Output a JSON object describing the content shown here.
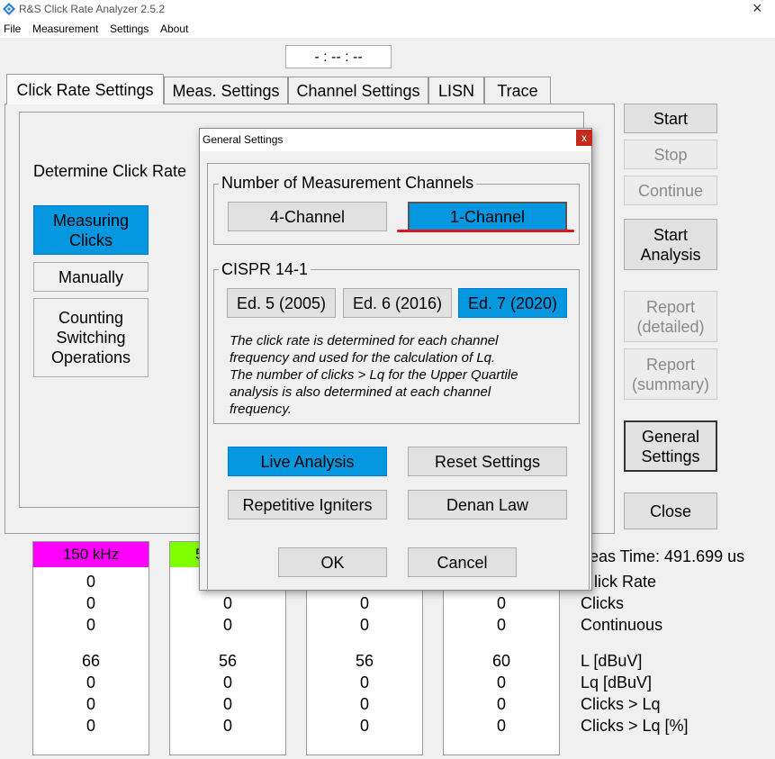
{
  "window": {
    "title": "R&S Click Rate Analyzer 2.5.2",
    "close_glyph": "×"
  },
  "menu": {
    "items": [
      "File",
      "Measurement",
      "Settings",
      "About"
    ]
  },
  "timer": "- :  --  :  --",
  "tabs": [
    "Click Rate Settings",
    "Meas. Settings",
    "Channel Settings",
    "LISN",
    "Trace"
  ],
  "click_rate": {
    "heading": "Determine Click Rate",
    "buttons": [
      "Measuring Clicks",
      "Manually",
      "Counting Switching Operations"
    ]
  },
  "right_buttons": {
    "start": "Start",
    "stop": "Stop",
    "continue": "Continue",
    "start_analysis": "Start Analysis",
    "report_detailed": "Report (detailed)",
    "report_summary": "Report (summary)",
    "general_settings": "General Settings",
    "close": "Close"
  },
  "channels": [
    {
      "header": "150 kHz",
      "header_color": "#ff00ff",
      "values": [
        "0",
        "0",
        "0",
        "66",
        "0",
        "0",
        "0"
      ]
    },
    {
      "header": "5",
      "header_color": "#7fff00",
      "values": [
        "",
        "0",
        "0",
        "56",
        "0",
        "0",
        "0"
      ]
    },
    {
      "header": "",
      "header_color": "#ffffff",
      "values": [
        "",
        "0",
        "0",
        "56",
        "0",
        "0",
        "0"
      ]
    },
    {
      "header": "",
      "header_color": "#ffffff",
      "values": [
        "",
        "0",
        "0",
        "60",
        "0",
        "0",
        "0"
      ]
    }
  ],
  "results": {
    "meas_time": "eas Time: 491.699 us",
    "labels": [
      "lick Rate",
      "Clicks",
      "Continuous",
      "L [dBuV]",
      "Lq [dBuV]",
      "Clicks > Lq",
      "Clicks > Lq [%]"
    ]
  },
  "dialog": {
    "title": "General Settings",
    "close_glyph": "x",
    "channels_group": {
      "title": "Number of Measurement Channels",
      "options": [
        "4-Channel",
        "1-Channel"
      ],
      "selected": "1-Channel"
    },
    "cispr_group": {
      "title": "CISPR 14-1",
      "options": [
        "Ed. 5 (2005)",
        "Ed. 6 (2016)",
        "Ed. 7 (2020)"
      ],
      "selected": "Ed. 7 (2020)",
      "note": [
        "The click rate is determined for each channel",
        "frequency and used for the calculation of Lq.",
        "The number of clicks > Lq for the Upper Quartile",
        "analysis is also determined at each channel",
        "frequency."
      ]
    },
    "buttons": {
      "live_analysis": "Live Analysis",
      "reset_settings": "Reset Settings",
      "repetitive_igniters": "Repetitive Igniters",
      "denan_law": "Denan Law",
      "ok": "OK",
      "cancel": "Cancel"
    }
  },
  "colors": {
    "accent_blue": "#0598e1",
    "annotation_red": "#e0151c"
  }
}
